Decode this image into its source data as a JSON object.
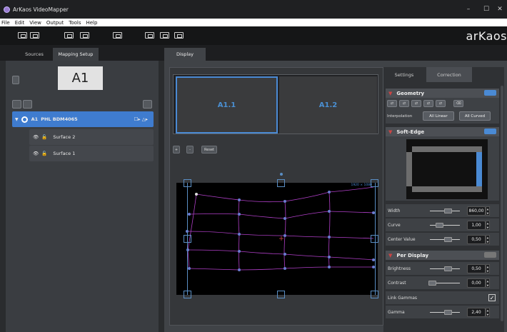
{
  "window": {
    "title": "ArKaos VideoMapper",
    "minimize": "–",
    "maximize": "☐",
    "close": "✕"
  },
  "menu": [
    "File",
    "Edit",
    "View",
    "Output",
    "Tools",
    "Help"
  ],
  "brand": {
    "logo": "arKaos"
  },
  "tabs": {
    "sources": "Sources",
    "mapping": "Mapping Setup",
    "display": "Display"
  },
  "preview": {
    "label": "A1"
  },
  "layers": {
    "group": {
      "id": "A1",
      "name": "PHL BDM4065",
      "icons": "☐▸ △▸"
    },
    "items": [
      "Surface 2",
      "Surface 1"
    ]
  },
  "display_thumbs": [
    "A1.1",
    "A1.2"
  ],
  "zoom": {
    "in": "+",
    "out": "-",
    "reset": "Reset"
  },
  "canvas": {
    "resolution": "1920 × 1080"
  },
  "panel": {
    "tabs": [
      "Settings",
      "Correction"
    ],
    "geometry": {
      "title": "Geometry",
      "interpolation_label": "Interpolation",
      "all_linear": "All Linear",
      "all_curved": "All Curved"
    },
    "soft_edge": {
      "title": "Soft-Edge",
      "width_label": "Width",
      "width_value": "860,00",
      "curve_label": "Curve",
      "curve_value": "1,00",
      "center_label": "Center Value",
      "center_value": "0,50"
    },
    "per_display": {
      "title": "Per Display",
      "brightness_label": "Brightness",
      "brightness_value": "0,50",
      "contrast_label": "Contrast",
      "contrast_value": "0,00",
      "link_label": "Link Gammas",
      "gamma_label": "Gamma",
      "gamma_value": "2,40"
    }
  },
  "colors": {
    "accent": "#4a8ad4",
    "selected_row": "#3f7ccf",
    "warp_lines": "#b03fc8",
    "red_arrow": "#c44444"
  }
}
